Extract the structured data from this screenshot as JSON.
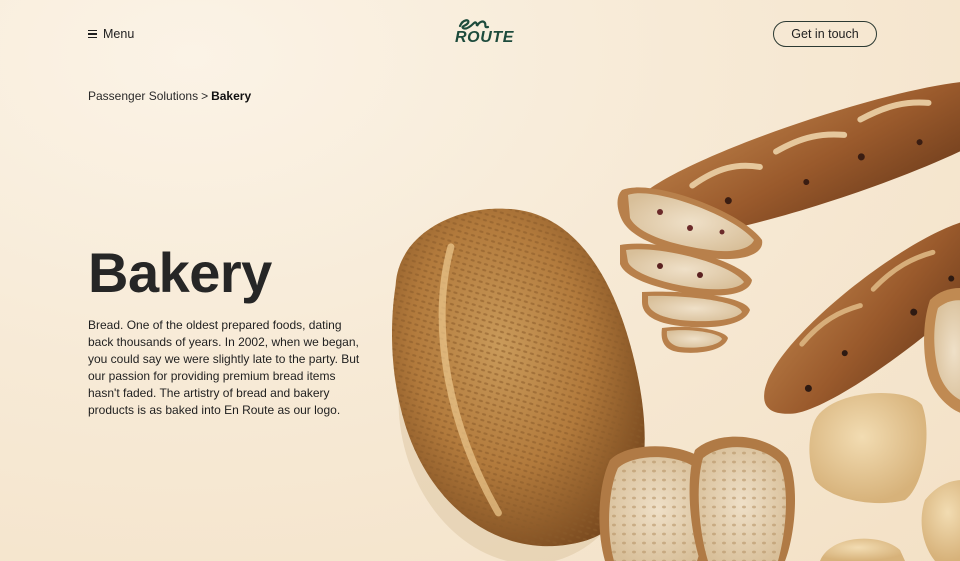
{
  "header": {
    "menu_label": "Menu",
    "logo_script": "en",
    "logo_word": "ROUTE",
    "cta_label": "Get in touch"
  },
  "breadcrumb": {
    "parent": "Passenger Solutions",
    "separator": ">",
    "current": "Bakery"
  },
  "hero": {
    "title": "Bakery",
    "body": "Bread. One of the oldest prepared foods, dating back thousands of years. In 2002, when we began, you could say we were slightly late to the party. But our passion for providing premium bread items hasn't faded. The artistry of bread and bakery products is as baked into En Route as our logo."
  },
  "colors": {
    "background": "#f7ead6",
    "brand_green": "#1d4b3c",
    "text": "#1f1f1f"
  },
  "icons": {
    "menu": "hamburger-icon"
  }
}
